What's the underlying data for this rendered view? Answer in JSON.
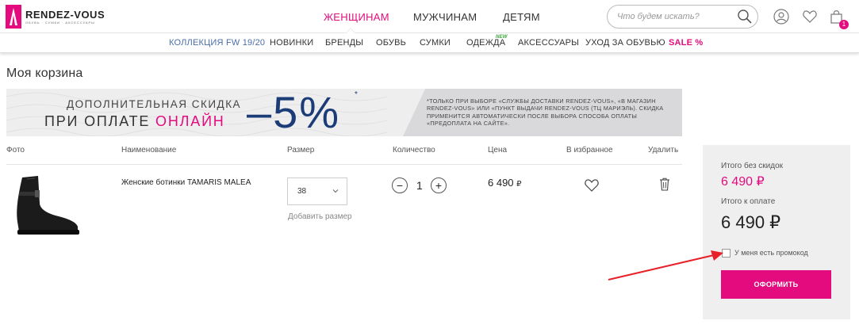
{
  "colors": {
    "accent": "#e30b7e",
    "navy": "#1c3c78",
    "link_blue": "#4a6ea8",
    "new_badge": "#3ba63b",
    "arrow": "#e8202a"
  },
  "header": {
    "logo": {
      "name": "RENDEZ-VOUS",
      "tagline": "ОБУВЬ · СУМКИ · АКСЕССУАРЫ"
    },
    "nav": [
      {
        "label": "ЖЕНЩИНАМ",
        "active": true
      },
      {
        "label": "МУЖЧИНАМ",
        "active": false
      },
      {
        "label": "ДЕТЯМ",
        "active": false
      }
    ],
    "search": {
      "placeholder": "Что будем искать?",
      "value": "",
      "icon": "search-icon"
    },
    "icons": [
      "user-icon",
      "heart-icon",
      "cart-icon"
    ],
    "cart_count": "1"
  },
  "subnav": {
    "items": [
      {
        "label": "КОЛЛЕКЦИЯ FW 19/20",
        "style": "blue"
      },
      {
        "label": "НОВИНКИ"
      },
      {
        "label": "БРЕНДЫ"
      },
      {
        "label": "ОБУВЬ"
      },
      {
        "label": "СУМКИ"
      },
      {
        "label": "ОДЕЖДА",
        "badge": "NEW"
      },
      {
        "label": "АКСЕССУАРЫ"
      },
      {
        "label": "УХОД ЗА ОБУВЬЮ"
      },
      {
        "label": "SALE %",
        "style": "sale"
      }
    ]
  },
  "page": {
    "title": "Моя корзина"
  },
  "banner": {
    "line1": "ДОПОЛНИТЕЛЬНАЯ СКИДКА",
    "line2_prefix": "ПРИ ОПЛАТЕ ",
    "line2_accent": "ОНЛАЙН",
    "discount": "–5%",
    "asterisk": "*",
    "note": "*только при выборе «службы доставки Rendez-Vous», «в магазин Rendez-Vous» или «пункт выдачи Rendez-Vous (ТЦ Мариэль). Скидка применится автоматически после выбора способа оплаты «предоплата на сайте»."
  },
  "cart": {
    "columns": [
      "Фото",
      "Наименование",
      "Размер",
      "Количество",
      "Цена",
      "В избранное",
      "Удалить"
    ],
    "items": [
      {
        "image": "black-ankle-boot",
        "name": "Женские ботинки TAMARIS MALEA",
        "size": "38",
        "add_size": "Добавить размер",
        "quantity": "1",
        "minus": "−",
        "plus": "+",
        "price": "6 490",
        "currency": "₽",
        "favorite_icon": "heart-outline-icon",
        "delete_icon": "trash-icon"
      }
    ]
  },
  "summary": {
    "subtotal_label": "Итого без скидок",
    "subtotal_value": "6 490 ₽",
    "total_label": "Итого к оплате",
    "total_value": "6 490 ₽",
    "promo_label": "У меня есть промокод",
    "promo_checked": false,
    "checkout_label": "ОФОРМИТЬ"
  }
}
